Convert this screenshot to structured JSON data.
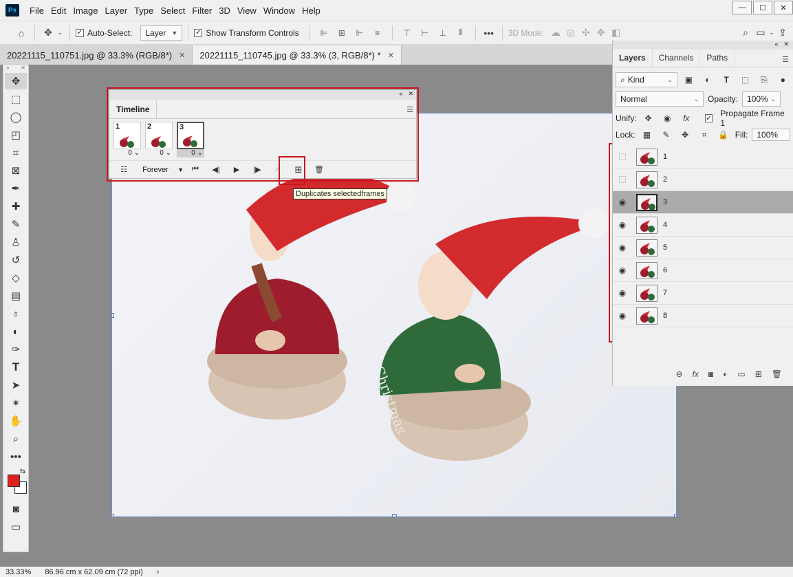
{
  "app": {
    "logo": "Ps"
  },
  "menu": [
    "File",
    "Edit",
    "Image",
    "Layer",
    "Type",
    "Select",
    "Filter",
    "3D",
    "View",
    "Window",
    "Help"
  ],
  "window_controls": {
    "minimize": "—",
    "maximize": "☐",
    "close": "✕"
  },
  "options": {
    "auto_select_label": "Auto-Select:",
    "auto_select_value": "Layer",
    "show_transform_label": "Show Transform Controls",
    "mode_3d_label": "3D Mode:"
  },
  "doc_tabs": [
    {
      "label": "20221115_110751.jpg @ 33.3% (RGB/8*)",
      "active": false
    },
    {
      "label": "20221115_110745.jpg @ 33.3% (3, RGB/8*) *",
      "active": true
    }
  ],
  "timeline": {
    "tab_label": "Timeline",
    "frames": [
      {
        "num": "1",
        "delay": "0",
        "selected": false
      },
      {
        "num": "2",
        "delay": "0",
        "selected": false
      },
      {
        "num": "3",
        "delay": "0",
        "selected": true
      }
    ],
    "loop_value": "Forever",
    "tooltip": "Duplicates selectedframes"
  },
  "layers_panel": {
    "tabs": [
      "Layers",
      "Channels",
      "Paths"
    ],
    "kind_filter": "Kind",
    "blend_mode": "Normal",
    "opacity_label": "Opacity:",
    "opacity_value": "100%",
    "unify_label": "Unify:",
    "propagate_label": "Propagate Frame 1",
    "lock_label": "Lock:",
    "fill_label": "Fill:",
    "fill_value": "100%",
    "layers": [
      {
        "name": "1",
        "visible": false,
        "selected": false
      },
      {
        "name": "2",
        "visible": false,
        "selected": false
      },
      {
        "name": "3",
        "visible": true,
        "selected": true
      },
      {
        "name": "4",
        "visible": true,
        "selected": false
      },
      {
        "name": "5",
        "visible": true,
        "selected": false
      },
      {
        "name": "6",
        "visible": true,
        "selected": false
      },
      {
        "name": "7",
        "visible": true,
        "selected": false
      },
      {
        "name": "8",
        "visible": true,
        "selected": false
      }
    ]
  },
  "status": {
    "zoom": "33.33%",
    "doc_size": "86.96 cm x 62.09 cm (72 ppi)"
  },
  "colors": {
    "foreground": "#e0201e",
    "background": "#ffffff",
    "highlight": "#c8161e"
  }
}
